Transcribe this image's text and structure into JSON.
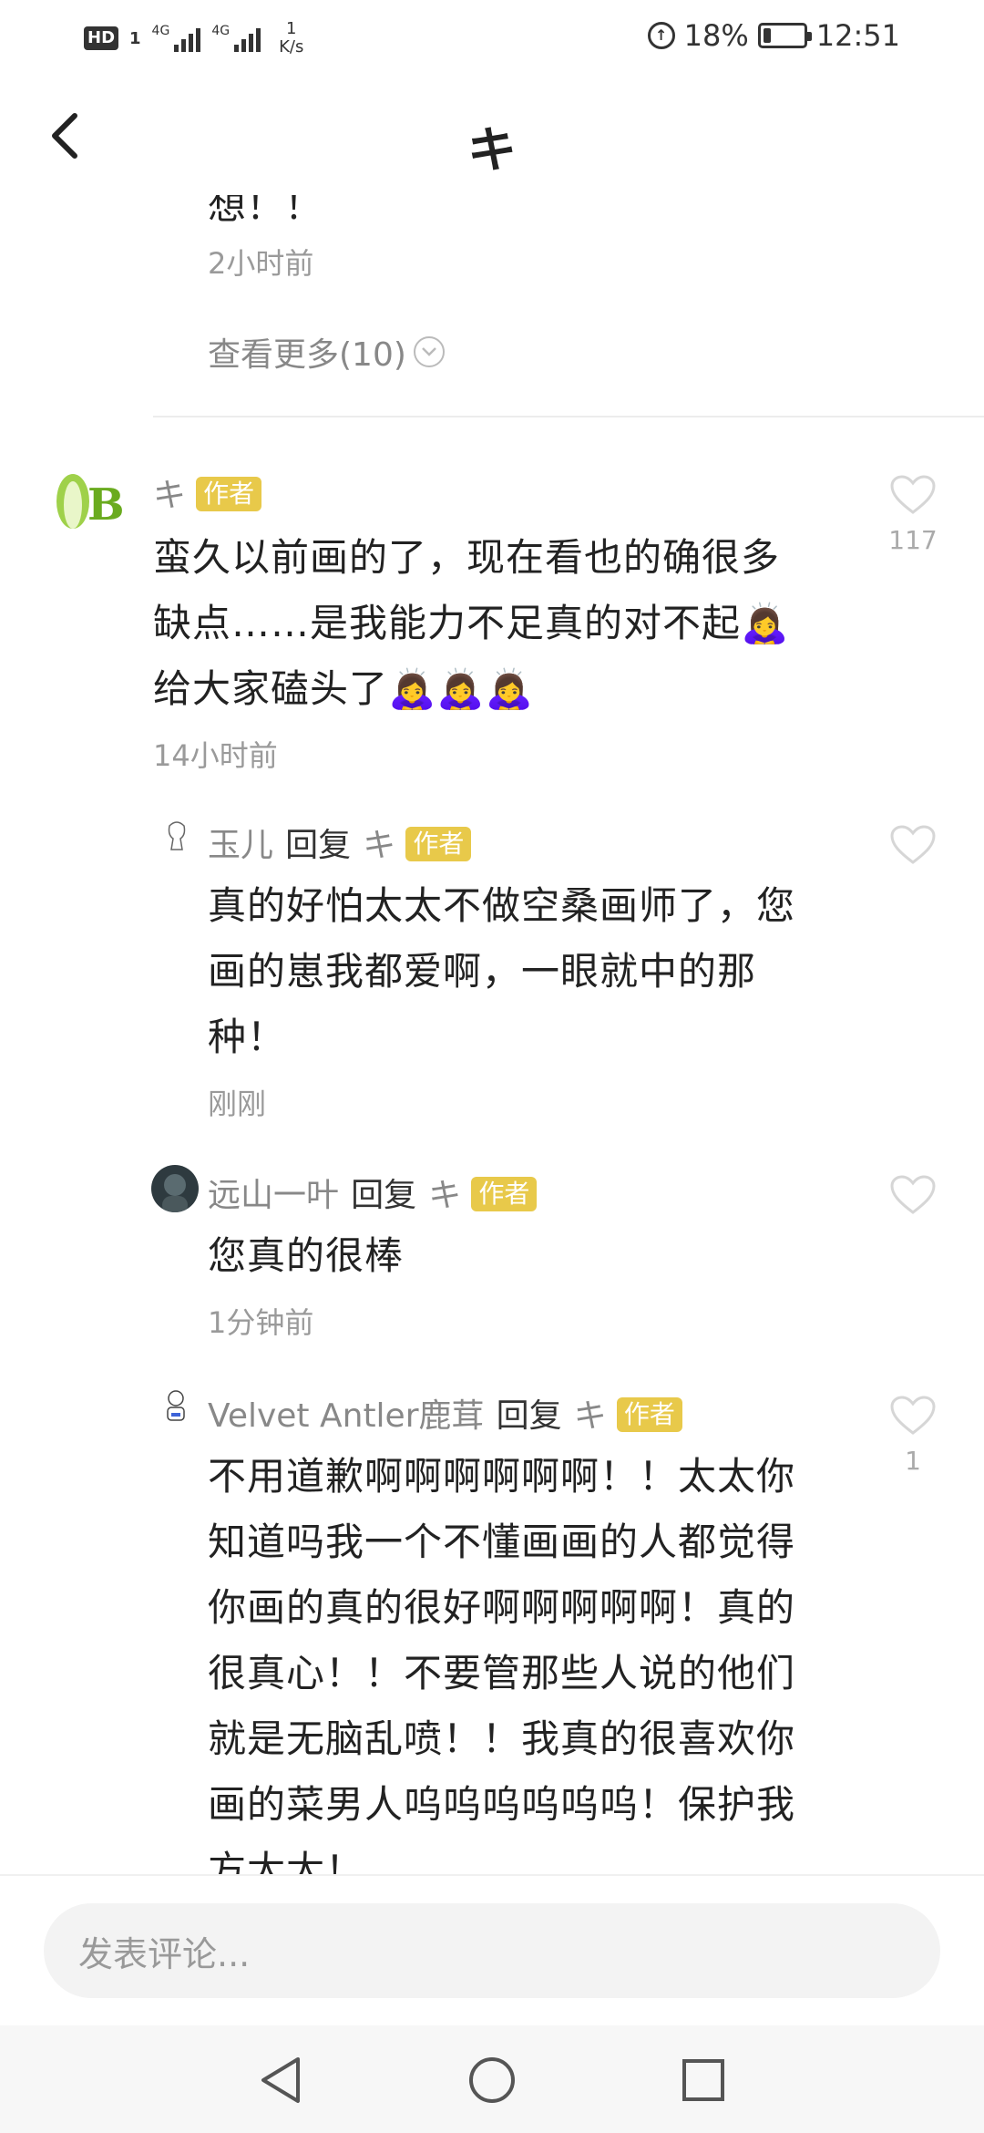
{
  "status_bar": {
    "hd": "HD",
    "sim1": "1",
    "net1": "4G",
    "net2": "4G",
    "speed_value": "1",
    "speed_unit": "K/s",
    "battery": "18%",
    "time": "12:51",
    "battery_level": 0.18
  },
  "header": {
    "title": "キ"
  },
  "prev_thread": {
    "partial_text": "想！！",
    "time": "2小时前",
    "more_label": "查看更多(10)"
  },
  "main_comment": {
    "name": "キ",
    "author_tag": "作者",
    "text_lines": [
      "蛮久以前画的了，现在看也的确很多",
      "缺点……是我能力不足真的对不起🙇‍♀️",
      "给大家磕头了🙇‍♀️🙇‍♀️🙇‍♀️"
    ],
    "time": "14小时前",
    "likes": "117"
  },
  "replies": [
    {
      "name": "玉儿",
      "reply_word": "回复",
      "target": "キ",
      "author_tag": "作者",
      "text_lines": [
        "真的好怕太太不做空桑画师了，您",
        "画的崽我都爱啊，一眼就中的那",
        "种！"
      ],
      "time": "刚刚",
      "likes": ""
    },
    {
      "name": "远山一叶",
      "reply_word": "回复",
      "target": "キ",
      "author_tag": "作者",
      "text_lines": [
        "您真的很棒"
      ],
      "time": "1分钟前",
      "likes": ""
    },
    {
      "name": "Velvet Antler鹿茸",
      "reply_word": "回复",
      "target": "キ",
      "author_tag": "作者",
      "text_lines": [
        "不用道歉啊啊啊啊啊啊！！太太你",
        "知道吗我一个不懂画画的人都觉得",
        "你画的真的很好啊啊啊啊啊！真的",
        "很真心！！不要管那些人说的他们",
        "就是无脑乱喷！！我真的很喜欢你",
        "画的菜男人呜呜呜呜呜呜！保护我",
        "方太太！"
      ],
      "time": "",
      "likes": "1"
    }
  ],
  "input": {
    "placeholder": "发表评论..."
  },
  "icons": {
    "back": "back-arrow-icon",
    "heart": "heart-outline-icon",
    "chevron": "chevron-down-circle-icon",
    "nav_back": "nav-back-triangle-icon",
    "nav_home": "nav-home-circle-icon",
    "nav_recent": "nav-recent-square-icon"
  },
  "colors": {
    "author_tag": "#e8c94a",
    "muted_text": "#9a9a9a"
  }
}
